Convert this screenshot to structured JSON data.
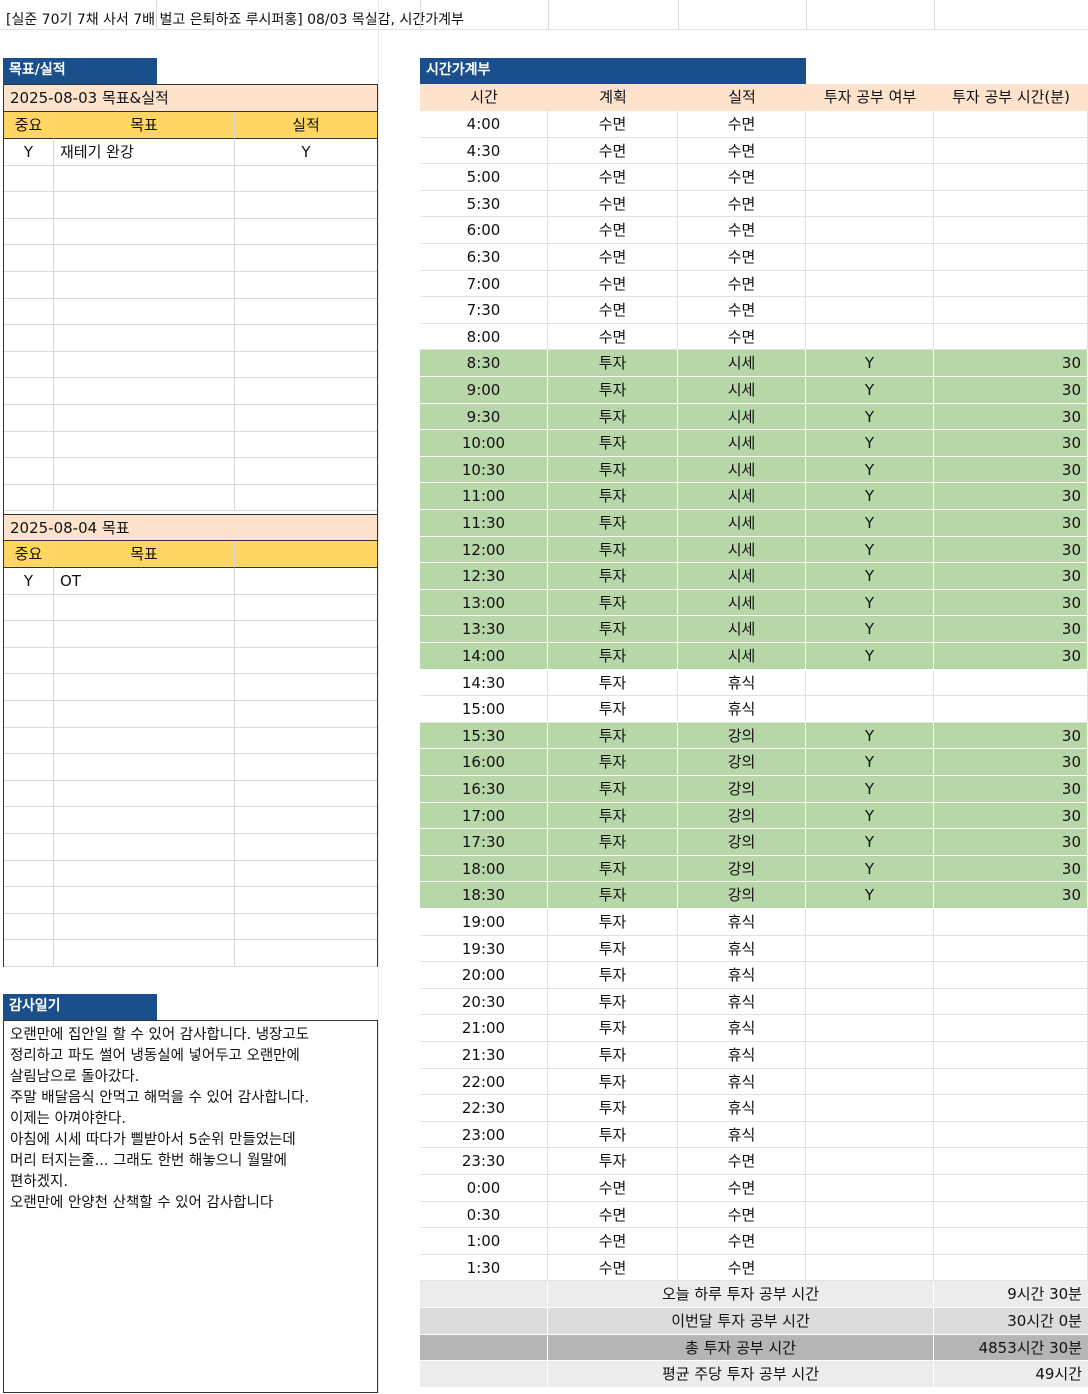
{
  "title": "[실준 70기 7채 사서 7배 벌고 은퇴하죠 루시퍼홍] 08/03 목실감, 시간가계부",
  "goals": {
    "section_label": "목표/실적",
    "today": {
      "date_label": "2025-08-03 목표&실적",
      "headers": [
        "중요",
        "목표",
        "실적"
      ],
      "rows": [
        {
          "important": "Y",
          "goal": "재테기 완강",
          "result": "Y"
        }
      ]
    },
    "tomorrow": {
      "date_label": "2025-08-04 목표",
      "headers": [
        "중요",
        "목표"
      ],
      "rows": [
        {
          "important": "Y",
          "goal": "OT"
        }
      ]
    }
  },
  "diary": {
    "section_label": "감사일기",
    "text": "오랜만에 집안일 할 수 있어 감사합니다. 냉장고도\n정리하고 파도 썰어 냉동실에 넣어두고 오랜만에\n살림남으로 돌아갔다.\n주말 배달음식 안먹고 해먹을 수 있어 감사합니다.\n이제는 아껴야한다.\n아침에 시세 따다가 삘받아서 5순위 만들었는데\n머리 터지는줄... 그래도 한번 해놓으니 월말에\n편하겠지.\n오랜만에 안양천 산책할 수 있어 감사합니다"
  },
  "timebook": {
    "section_label": "시간가계부",
    "headers": [
      "시간",
      "계획",
      "실적",
      "투자 공부 여부",
      "투자 공부 시간(분)"
    ],
    "rows": [
      {
        "time": "4:00",
        "plan": "수면",
        "actual": "수면",
        "study": "",
        "minutes": ""
      },
      {
        "time": "4:30",
        "plan": "수면",
        "actual": "수면",
        "study": "",
        "minutes": ""
      },
      {
        "time": "5:00",
        "plan": "수면",
        "actual": "수면",
        "study": "",
        "minutes": ""
      },
      {
        "time": "5:30",
        "plan": "수면",
        "actual": "수면",
        "study": "",
        "minutes": ""
      },
      {
        "time": "6:00",
        "plan": "수면",
        "actual": "수면",
        "study": "",
        "minutes": ""
      },
      {
        "time": "6:30",
        "plan": "수면",
        "actual": "수면",
        "study": "",
        "minutes": ""
      },
      {
        "time": "7:00",
        "plan": "수면",
        "actual": "수면",
        "study": "",
        "minutes": ""
      },
      {
        "time": "7:30",
        "plan": "수면",
        "actual": "수면",
        "study": "",
        "minutes": ""
      },
      {
        "time": "8:00",
        "plan": "수면",
        "actual": "수면",
        "study": "",
        "minutes": ""
      },
      {
        "time": "8:30",
        "plan": "투자",
        "actual": "시세",
        "study": "Y",
        "minutes": "30"
      },
      {
        "time": "9:00",
        "plan": "투자",
        "actual": "시세",
        "study": "Y",
        "minutes": "30"
      },
      {
        "time": "9:30",
        "plan": "투자",
        "actual": "시세",
        "study": "Y",
        "minutes": "30"
      },
      {
        "time": "10:00",
        "plan": "투자",
        "actual": "시세",
        "study": "Y",
        "minutes": "30"
      },
      {
        "time": "10:30",
        "plan": "투자",
        "actual": "시세",
        "study": "Y",
        "minutes": "30"
      },
      {
        "time": "11:00",
        "plan": "투자",
        "actual": "시세",
        "study": "Y",
        "minutes": "30"
      },
      {
        "time": "11:30",
        "plan": "투자",
        "actual": "시세",
        "study": "Y",
        "minutes": "30"
      },
      {
        "time": "12:00",
        "plan": "투자",
        "actual": "시세",
        "study": "Y",
        "minutes": "30"
      },
      {
        "time": "12:30",
        "plan": "투자",
        "actual": "시세",
        "study": "Y",
        "minutes": "30"
      },
      {
        "time": "13:00",
        "plan": "투자",
        "actual": "시세",
        "study": "Y",
        "minutes": "30"
      },
      {
        "time": "13:30",
        "plan": "투자",
        "actual": "시세",
        "study": "Y",
        "minutes": "30"
      },
      {
        "time": "14:00",
        "plan": "투자",
        "actual": "시세",
        "study": "Y",
        "minutes": "30"
      },
      {
        "time": "14:30",
        "plan": "투자",
        "actual": "휴식",
        "study": "",
        "minutes": ""
      },
      {
        "time": "15:00",
        "plan": "투자",
        "actual": "휴식",
        "study": "",
        "minutes": ""
      },
      {
        "time": "15:30",
        "plan": "투자",
        "actual": "강의",
        "study": "Y",
        "minutes": "30"
      },
      {
        "time": "16:00",
        "plan": "투자",
        "actual": "강의",
        "study": "Y",
        "minutes": "30"
      },
      {
        "time": "16:30",
        "plan": "투자",
        "actual": "강의",
        "study": "Y",
        "minutes": "30"
      },
      {
        "time": "17:00",
        "plan": "투자",
        "actual": "강의",
        "study": "Y",
        "minutes": "30"
      },
      {
        "time": "17:30",
        "plan": "투자",
        "actual": "강의",
        "study": "Y",
        "minutes": "30"
      },
      {
        "time": "18:00",
        "plan": "투자",
        "actual": "강의",
        "study": "Y",
        "minutes": "30"
      },
      {
        "time": "18:30",
        "plan": "투자",
        "actual": "강의",
        "study": "Y",
        "minutes": "30"
      },
      {
        "time": "19:00",
        "plan": "투자",
        "actual": "휴식",
        "study": "",
        "minutes": ""
      },
      {
        "time": "19:30",
        "plan": "투자",
        "actual": "휴식",
        "study": "",
        "minutes": ""
      },
      {
        "time": "20:00",
        "plan": "투자",
        "actual": "휴식",
        "study": "",
        "minutes": ""
      },
      {
        "time": "20:30",
        "plan": "투자",
        "actual": "휴식",
        "study": "",
        "minutes": ""
      },
      {
        "time": "21:00",
        "plan": "투자",
        "actual": "휴식",
        "study": "",
        "minutes": ""
      },
      {
        "time": "21:30",
        "plan": "투자",
        "actual": "휴식",
        "study": "",
        "minutes": ""
      },
      {
        "time": "22:00",
        "plan": "투자",
        "actual": "휴식",
        "study": "",
        "minutes": ""
      },
      {
        "time": "22:30",
        "plan": "투자",
        "actual": "휴식",
        "study": "",
        "minutes": ""
      },
      {
        "time": "23:00",
        "plan": "투자",
        "actual": "휴식",
        "study": "",
        "minutes": ""
      },
      {
        "time": "23:30",
        "plan": "투자",
        "actual": "수면",
        "study": "",
        "minutes": ""
      },
      {
        "time": "0:00",
        "plan": "수면",
        "actual": "수면",
        "study": "",
        "minutes": ""
      },
      {
        "time": "0:30",
        "plan": "수면",
        "actual": "수면",
        "study": "",
        "minutes": ""
      },
      {
        "time": "1:00",
        "plan": "수면",
        "actual": "수면",
        "study": "",
        "minutes": ""
      },
      {
        "time": "1:30",
        "plan": "수면",
        "actual": "수면",
        "study": "",
        "minutes": ""
      }
    ],
    "summary": [
      {
        "label": "오늘 하루 투자 공부 시간",
        "value": "9시간 30분"
      },
      {
        "label": "이번달 투자 공부 시간",
        "value": "30시간 0분"
      },
      {
        "label": "총 투자 공부 시간",
        "value": "4853시간 30분"
      },
      {
        "label": "평균 주당 투자 공부 시간",
        "value": "49시간"
      }
    ]
  },
  "colors": {
    "header_blue": "#1a4f8b",
    "peach": "#fde3cc",
    "gold": "#ffd663",
    "study_green": "#b7d7a8"
  }
}
